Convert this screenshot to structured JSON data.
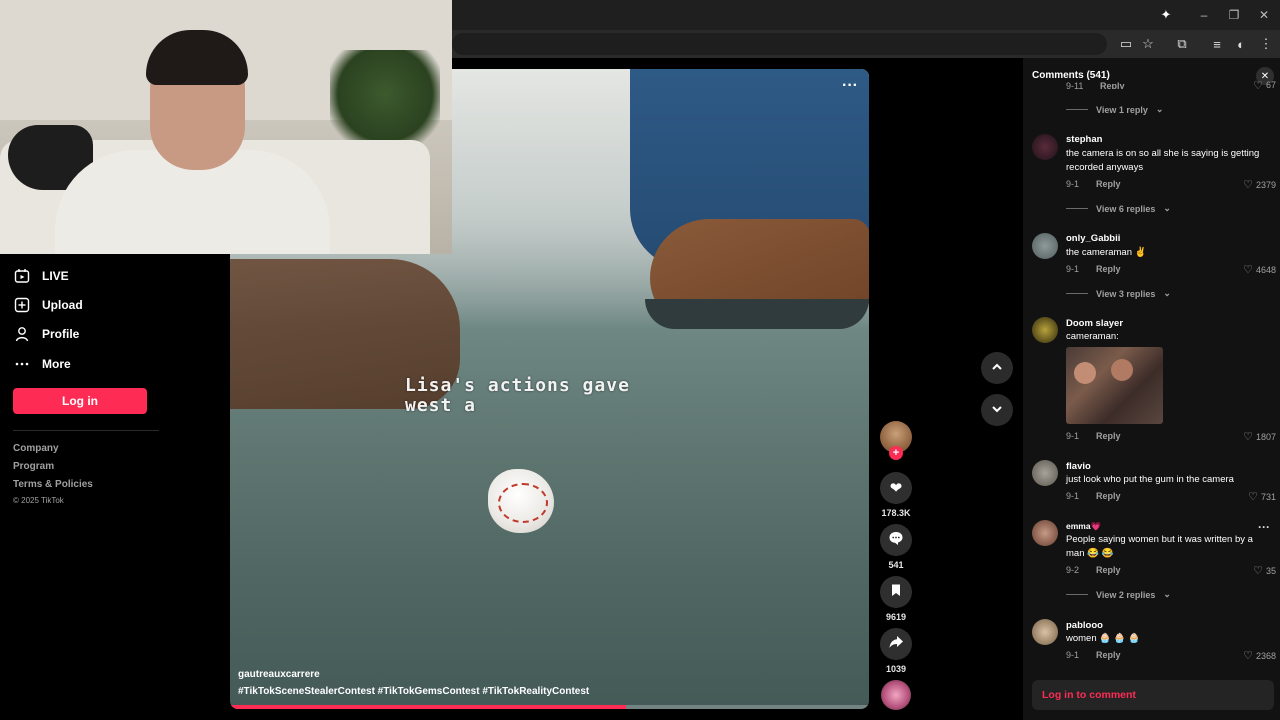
{
  "browser": {
    "toolbar_icons": [
      "sparkle-icon",
      "minimize-icon",
      "restore-icon",
      "close-icon",
      "cast-icon",
      "bookmark-star-icon",
      "tab-search-icon",
      "reading-list-icon",
      "extension-icon",
      "kebab-menu-icon"
    ]
  },
  "sidebar": {
    "items": [
      {
        "label": "LIVE",
        "icon": "live-icon"
      },
      {
        "label": "Upload",
        "icon": "upload-icon"
      },
      {
        "label": "Profile",
        "icon": "profile-icon"
      },
      {
        "label": "More",
        "icon": "more-icon"
      }
    ],
    "login_label": "Log in",
    "footer_links": [
      "Company",
      "Program",
      "Terms & Policies"
    ],
    "copyright": "© 2025 TikTok"
  },
  "video": {
    "caption_line1": "Lisa's actions gave",
    "caption_line2": "west a",
    "author": "gautreauxcarrere",
    "hashtags": "#TikTokSceneStealerContest #TikTokGemsContest #TikTokRealityContest",
    "progress": 0.62
  },
  "actions": {
    "likes": "178.3K",
    "comments": "541",
    "saves": "9619",
    "shares": "1039"
  },
  "comments": {
    "title": "Comments (541)",
    "top_partial": {
      "date": "9-11",
      "reply_label": "Reply",
      "likes": "67"
    },
    "view_reply_first": "View 1 reply",
    "items": [
      {
        "user": "stephan",
        "text": "the camera is on so all she is saying is getting recorded anyways",
        "date": "9-1",
        "reply": "Reply",
        "likes": "2379",
        "view_replies": "View 6 replies"
      },
      {
        "user": "only_Gabbii",
        "text": "the cameraman ✌",
        "date": "9-1",
        "reply": "Reply",
        "likes": "4648",
        "view_replies": "View 3 replies"
      },
      {
        "user": "Doom slayer",
        "text": "cameraman:",
        "date": "9-1",
        "reply": "Reply",
        "likes": "1807"
      },
      {
        "user": "flavio",
        "text": "just look who put the gum in the camera",
        "date": "9-1",
        "reply": "Reply",
        "likes": "731"
      },
      {
        "user": "emma💗",
        "text": "People saying women but it was written by a man 😂 😂",
        "date": "9-2",
        "reply": "Reply",
        "likes": "35",
        "view_replies": "View 2 replies"
      },
      {
        "user": "pablooo",
        "text": "women 🧁 🧁 🧁",
        "date": "9-1",
        "reply": "Reply",
        "likes": "2368"
      }
    ],
    "login_prompt": "Log in to comment"
  },
  "colors": {
    "accent": "#fe2c55",
    "panel_bg": "#121212",
    "muted_text": "#a0a0a0"
  }
}
